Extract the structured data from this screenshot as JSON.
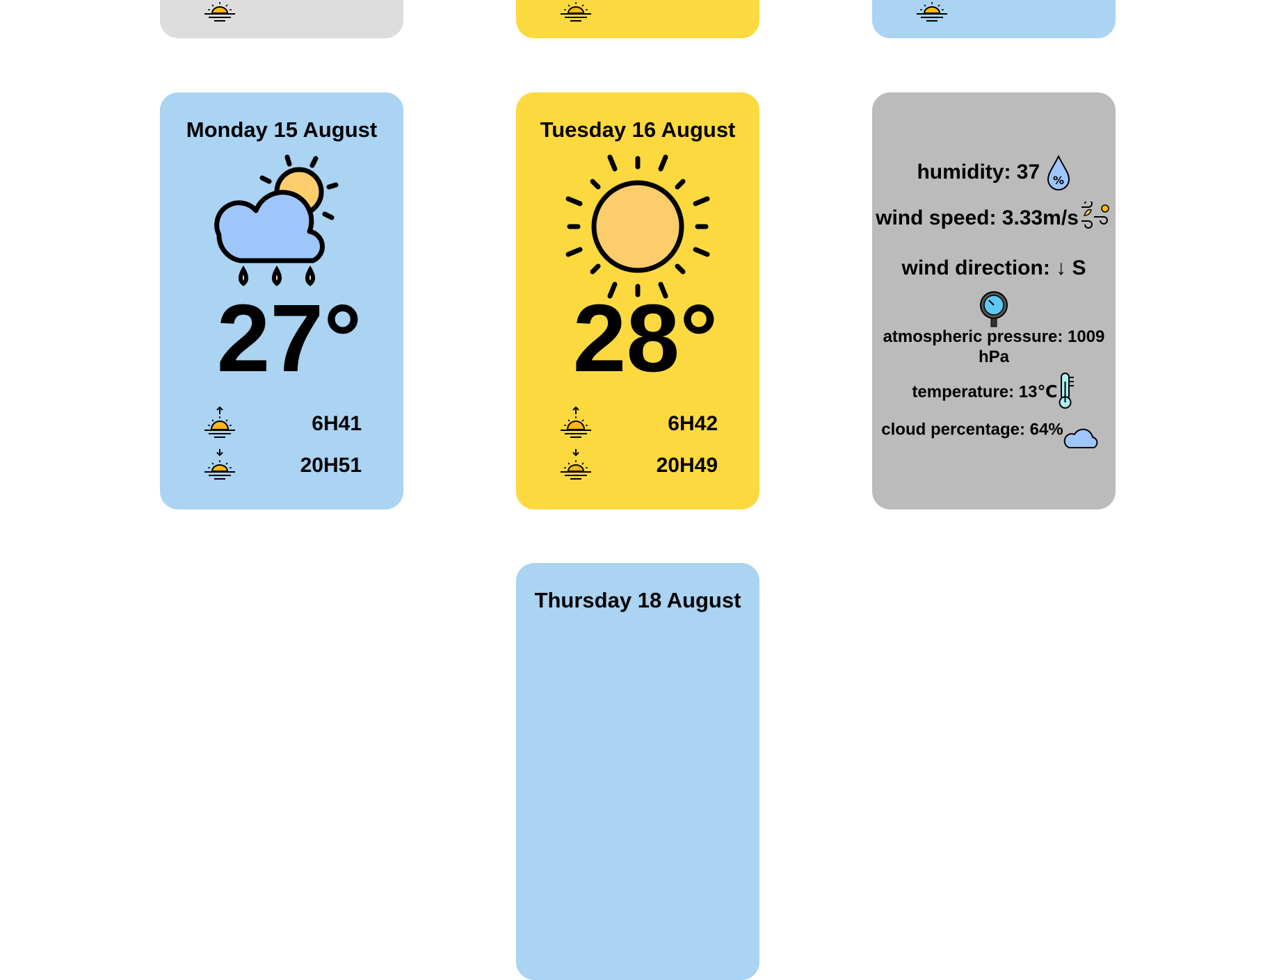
{
  "colors": {
    "blue": "#abd3f2",
    "yellow": "#fcd93f",
    "light_gray": "#dddddd",
    "gray": "#bbbbbb"
  },
  "top_row": [
    {
      "color": "light_gray",
      "icon": "sunset-icon"
    },
    {
      "color": "yellow",
      "icon": "sunset-icon"
    },
    {
      "color": "blue",
      "icon": "sunset-icon"
    }
  ],
  "cards": [
    {
      "date": "Monday 15 August",
      "icon": "cloud-sun-rain-icon",
      "temperature": "27°",
      "sunrise": "6H41",
      "sunset": "20H51",
      "color": "blue"
    },
    {
      "date": "Tuesday 16 August",
      "icon": "sun-icon",
      "temperature": "28°",
      "sunrise": "6H42",
      "sunset": "20H49",
      "color": "yellow"
    }
  ],
  "details": {
    "humidity": "humidity: 37",
    "wind_speed": "wind speed: 3.33m/s",
    "wind_direction": "wind direction: ↓ S",
    "pressure": "atmospheric pressure: 1009 hPa",
    "temperature": "temperature: 13℃",
    "clouds": "cloud percentage: 64%"
  },
  "bottom_card": {
    "date": "Thursday 18 August",
    "color": "blue"
  }
}
